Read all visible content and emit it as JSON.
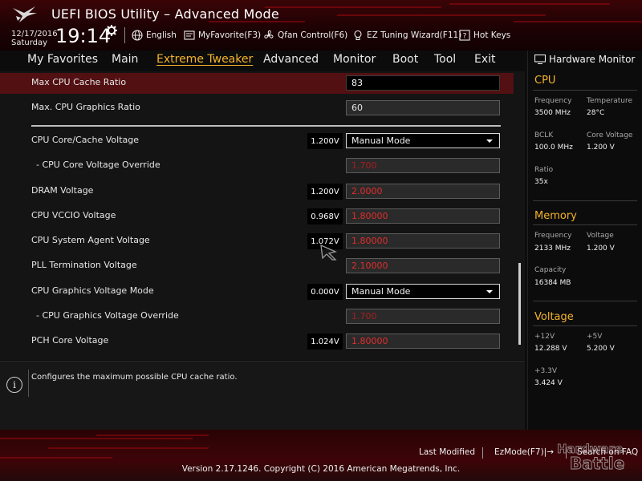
{
  "header": {
    "title": "UEFI BIOS Utility – Advanced Mode",
    "date": "12/17/2016",
    "day": "Saturday",
    "time": "19:14",
    "buttons": {
      "language": "English",
      "my_favorite": "MyFavorite(F3)",
      "qfan": "Qfan Control(F6)",
      "ez_tuning": "EZ Tuning Wizard(F11)",
      "hot_keys": "Hot Keys"
    }
  },
  "nav": {
    "tabs": [
      "My Favorites",
      "Main",
      "Extreme Tweaker",
      "Advanced",
      "Monitor",
      "Boot",
      "Tool",
      "Exit"
    ],
    "active": "Extreme Tweaker"
  },
  "settings": [
    {
      "label": "Max CPU Cache Ratio",
      "value": "83"
    },
    {
      "label": "Max. CPU Graphics Ratio",
      "value": "60"
    },
    {
      "label": "CPU Core/Cache Voltage",
      "current": "1.200V",
      "value": "Manual Mode"
    },
    {
      "label": "- CPU Core Voltage Override",
      "value": "1.700"
    },
    {
      "label": "DRAM Voltage",
      "current": "1.200V",
      "value": "2.0000"
    },
    {
      "label": "CPU VCCIO Voltage",
      "current": "0.968V",
      "value": "1.80000"
    },
    {
      "label": "CPU System Agent Voltage",
      "current": "1.072V",
      "value": "1.80000"
    },
    {
      "label": "PLL Termination Voltage",
      "value": "2.10000"
    },
    {
      "label": "CPU Graphics Voltage Mode",
      "current": "0.000V",
      "value": "Manual Mode"
    },
    {
      "label": "- CPU Graphics Voltage Override",
      "value": "1.700"
    },
    {
      "label": "PCH Core Voltage",
      "current": "1.024V",
      "value": "1.80000"
    }
  ],
  "info": {
    "description": "Configures the maximum possible CPU cache ratio."
  },
  "hardware_monitor": {
    "title": "Hardware Monitor",
    "cpu": {
      "heading": "CPU",
      "frequency_label": "Frequency",
      "frequency": "3500 MHz",
      "temperature_label": "Temperature",
      "temperature": "28°C",
      "bclk_label": "BCLK",
      "bclk": "100.0 MHz",
      "core_voltage_label": "Core Voltage",
      "core_voltage": "1.200 V",
      "ratio_label": "Ratio",
      "ratio": "35x"
    },
    "memory": {
      "heading": "Memory",
      "frequency_label": "Frequency",
      "frequency": "2133 MHz",
      "voltage_label": "Voltage",
      "voltage": "1.200 V",
      "capacity_label": "Capacity",
      "capacity": "16384 MB"
    },
    "voltage": {
      "heading": "Voltage",
      "v12_label": "+12V",
      "v12": "12.288 V",
      "v5_label": "+5V",
      "v5": "5.200 V",
      "v33_label": "+3.3V",
      "v33": "3.424 V"
    }
  },
  "footer": {
    "last_modified": "Last Modified",
    "ez_mode": "EzMode(F7)|→",
    "search_faq": "Search on FAQ",
    "copyright": "Version 2.17.1246. Copyright (C) 2016 American Megatrends, Inc."
  },
  "watermark": {
    "line1": "Hardware",
    "line2": "Battle"
  },
  "colors": {
    "accent": "#f4b32a",
    "highlight_row": "#521012",
    "red_value": "#e22d2d",
    "header_red": "#3a0406"
  }
}
